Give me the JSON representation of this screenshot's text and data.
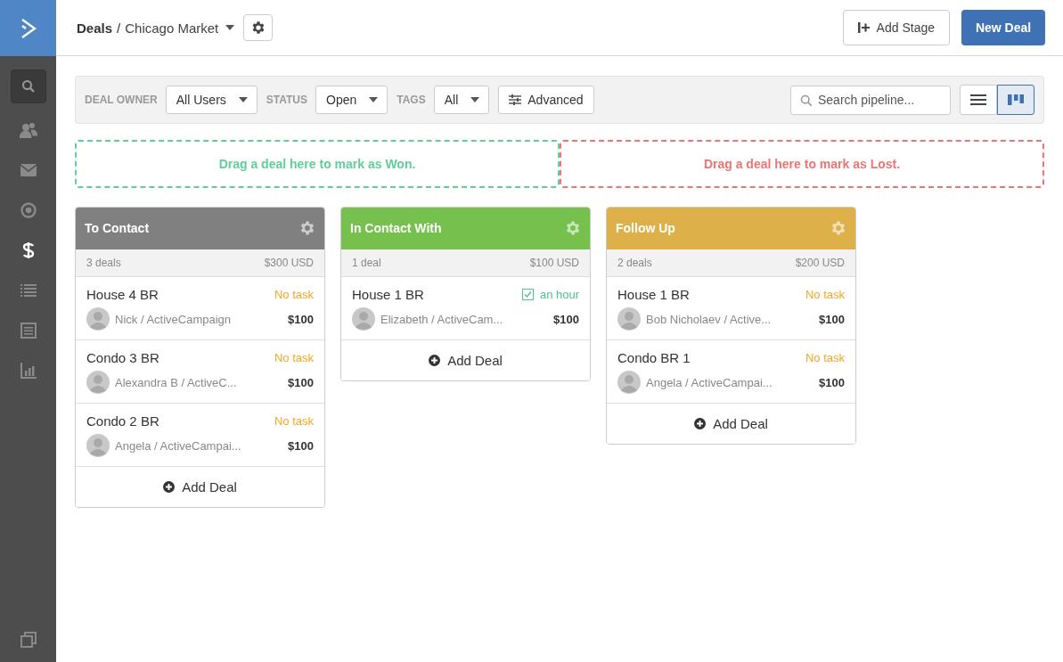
{
  "sidebar": {
    "items": [
      {
        "kind": "contacts",
        "selected": false
      },
      {
        "kind": "mail",
        "selected": false
      },
      {
        "kind": "automation",
        "selected": false
      },
      {
        "kind": "dollar",
        "selected": true
      },
      {
        "kind": "list",
        "selected": false
      },
      {
        "kind": "document",
        "selected": false
      },
      {
        "kind": "chart",
        "selected": false
      }
    ]
  },
  "header": {
    "breadcrumb_root": "Deals",
    "separator": "/",
    "pipeline": "Chicago Market",
    "add_stage": "Add Stage",
    "new_deal": "New Deal"
  },
  "filters": [
    {
      "label": "DEAL OWNER",
      "value": "All Users"
    },
    {
      "label": "STATUS",
      "value": "Open"
    },
    {
      "label": "TAGS",
      "value": "All"
    }
  ],
  "advanced": "Advanced",
  "search": {
    "placeholder": "Search pipeline..."
  },
  "views": [
    {
      "kind": "list",
      "selected": false
    },
    {
      "kind": "board",
      "selected": true
    }
  ],
  "drop_zones": [
    {
      "text": "Drag a deal here to mark as Won.",
      "color": "#5fcf9a"
    },
    {
      "text": "Drag a deal here to mark as Lost.",
      "color": "#f07474"
    }
  ],
  "stages": [
    {
      "title": "To Contact",
      "color": "#808080",
      "count": "3 deals",
      "total": "$300 USD",
      "add": "Add Deal",
      "deals": [
        {
          "title": "House 4 BR",
          "task_done": false,
          "task": "No task",
          "owner": "Nick / ActiveCampaign",
          "amount": "$100"
        },
        {
          "title": "Condo 3 BR",
          "task_done": false,
          "task": "No task",
          "owner": "Alexandra B / ActiveC...",
          "amount": "$100"
        },
        {
          "title": "Condo 2 BR",
          "task_done": false,
          "task": "No task",
          "owner": "Angela / ActiveCampai...",
          "amount": "$100"
        }
      ]
    },
    {
      "title": "In Contact With",
      "color": "#76c04e",
      "count": "1 deal",
      "total": "$100 USD",
      "add": "Add Deal",
      "deals": [
        {
          "title": "House 1 BR",
          "task_done": true,
          "task": "an hour",
          "owner": "Elizabeth / ActiveCam...",
          "amount": "$100"
        }
      ]
    },
    {
      "title": "Follow Up",
      "color": "#ddb04a",
      "count": "2 deals",
      "total": "$200 USD",
      "add": "Add Deal",
      "deals": [
        {
          "title": "House 1 BR",
          "task_done": false,
          "task": "No task",
          "owner": "Bob Nicholaev / Active...",
          "amount": "$100"
        },
        {
          "title": "Condo BR 1",
          "task_done": false,
          "task": "No task",
          "owner": "Angela / ActiveCampai...",
          "amount": "$100"
        }
      ]
    }
  ]
}
